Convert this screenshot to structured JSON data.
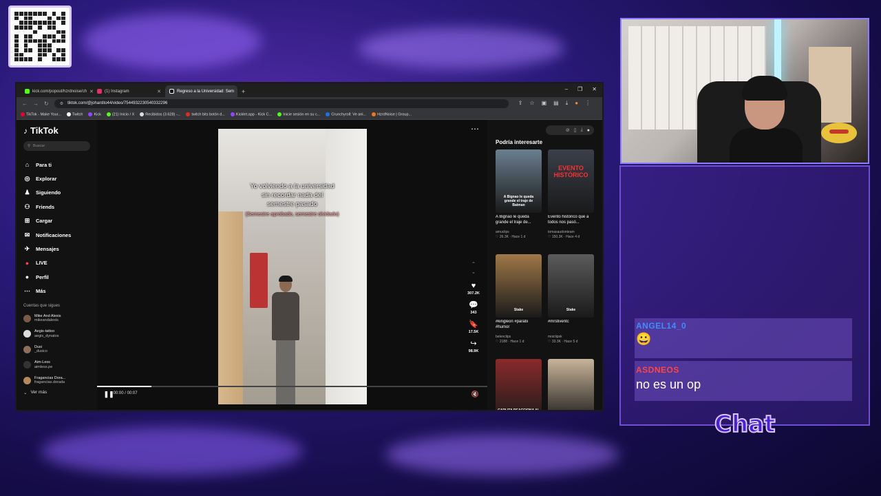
{
  "browser": {
    "tabs": [
      {
        "label": "kick.com/popout/hzrdnoise/ch",
        "color": "#53fc18"
      },
      {
        "label": "(1) Instagram",
        "color": "#e1306c"
      },
      {
        "label": "Regreso a la Universidad: Sem",
        "color": "#111111"
      }
    ],
    "url": "tiktok.com/@johantito44/video/7544932230540332296",
    "bookmarks": [
      "TikTok - Make Your...",
      "Twitch",
      "Kick",
      "(21) Inicio / X",
      "Recibidos (3.628) -...",
      "twitch bits botón d...",
      "Kicklet.app - Kick C...",
      "Inicie sesión en su c...",
      "Crunchyroll: Ve ani...",
      "HzrdNoise | Group..."
    ]
  },
  "tiktok": {
    "logo": "TikTok",
    "search_placeholder": "Buscar",
    "nav": [
      {
        "label": "Para ti",
        "icon": "home-icon"
      },
      {
        "label": "Explorar",
        "icon": "compass-icon"
      },
      {
        "label": "Siguiendo",
        "icon": "following-icon"
      },
      {
        "label": "Friends",
        "icon": "friends-icon"
      },
      {
        "label": "Cargar",
        "icon": "upload-icon"
      },
      {
        "label": "Notificaciones",
        "icon": "bell-icon"
      },
      {
        "label": "Mensajes",
        "icon": "message-icon"
      },
      {
        "label": "LIVE",
        "icon": "live-icon"
      },
      {
        "label": "Perfil",
        "icon": "profile-icon"
      },
      {
        "label": "Más",
        "icon": "more-icon"
      }
    ],
    "following_title": "Cuentas que sigues",
    "following": [
      {
        "name": "Mike And Alexis",
        "handle": "mikeandalexis"
      },
      {
        "name": "Aegis-tattoo",
        "handle": "aegis_dynatos"
      },
      {
        "name": "Dusi",
        "handle": "_dusico"
      },
      {
        "name": "Aim-Less",
        "handle": "aimless.pe"
      },
      {
        "name": "Fragancias Dora...",
        "handle": "fragancias.dorada"
      }
    ],
    "see_more": "Ver más",
    "video": {
      "caption_lines": [
        "Yo volviendo a la universidad",
        "sin recordar nada del",
        "semestre pasado"
      ],
      "caption_sub": "(Semestre aprobado, semestre olvidado)",
      "time": "00:00 / 00:07",
      "progress": 0.14,
      "likes": "307.2K",
      "comments": "343",
      "saves": "17.5K",
      "shares": "98.9K"
    },
    "recommend_title": "Podría interesarte",
    "recommendations": [
      {
        "caption": "A Bignao le queda grande el traje de...",
        "author": "amuclips",
        "stats": "♡ 26.3K · Hace 1 d",
        "color": "#6b7f8f",
        "overlay": "A Bignao le queda grande el traje de Batman"
      },
      {
        "caption": "Evento histórico que a todos nos pasó...",
        "author": "tomasaudonteam",
        "stats": "♡ 150.3K · Hace 4 d",
        "color": "#3a3f4a",
        "overlay": "EVENTO HISTÓRICO"
      },
      {
        "caption": "#kingleon #paratii #humor",
        "author": "belenclips",
        "stats": "♡ 2188 · Hace 1 d",
        "color": "#a07848",
        "overlay": "Stake"
      },
      {
        "caption": "#mrstiventc",
        "author": "moiclipsk",
        "stats": "♡ 33.3K · Hace 5 d",
        "color": "#5b5b5b",
        "overlay": "Stake"
      },
      {
        "caption": "",
        "author": "",
        "stats": "",
        "color": "#8a2a2a",
        "overlay": "CARLITA REACCIONA AL #CODIGOASPYPERUYY"
      },
      {
        "caption": "",
        "author": "",
        "stats": "",
        "color": "#c8b49a",
        "overlay": ""
      }
    ]
  },
  "chat": {
    "messages": [
      {
        "user": "ANGEL14_0",
        "text": "",
        "emote": "😀"
      },
      {
        "user": "ASDNEOS",
        "text": "no es un op",
        "emote": ""
      }
    ],
    "label": "Chat"
  }
}
